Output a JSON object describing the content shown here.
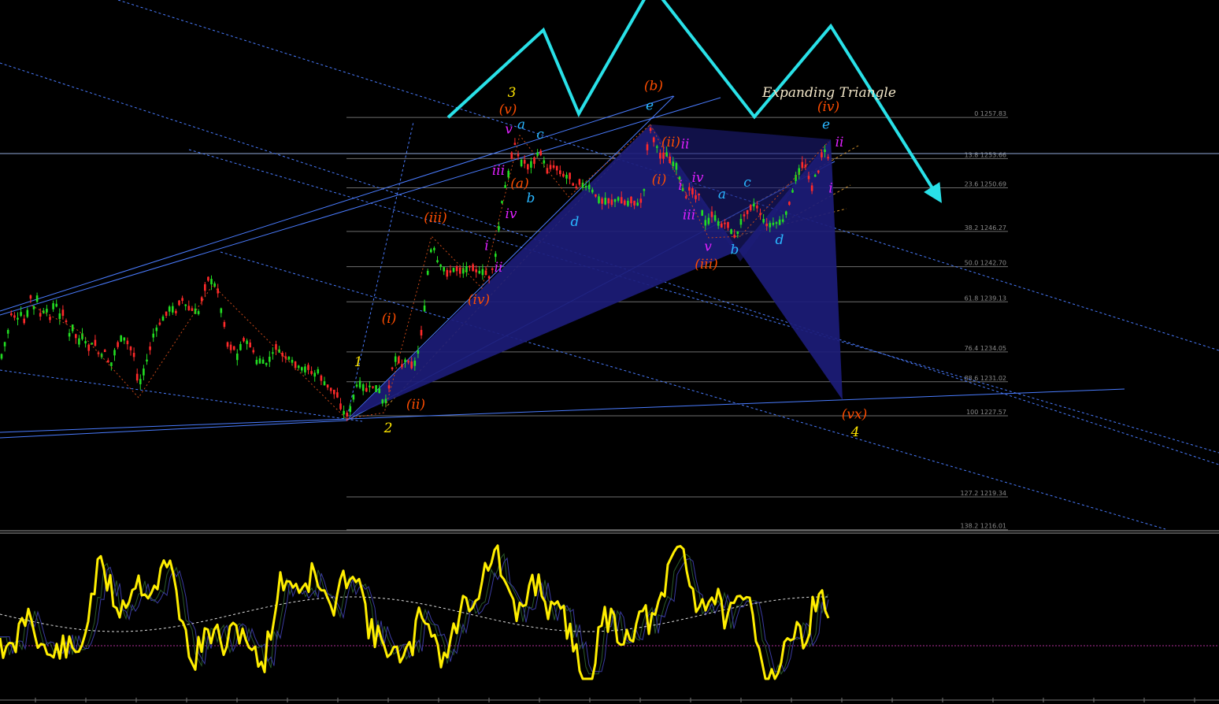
{
  "chart_data": [
    {
      "type": "candlestick",
      "title": "Expanding Triangle",
      "colors": {
        "up": "#22dd22",
        "down": "#ff2a2a",
        "pattern_fill": "#1c1c78",
        "projection": "#29e1e8",
        "fib_line": "#6e6e6e",
        "channel": "#4a7cff"
      },
      "fib_levels": [
        {
          "label": "0 1257.83",
          "price": 1257.83
        },
        {
          "label": "13.8 1253.66",
          "price": 1253.66
        },
        {
          "label": "23.6 1250.69",
          "price": 1250.69
        },
        {
          "label": "38.2 1246.27",
          "price": 1246.27
        },
        {
          "label": "50.0 1242.70",
          "price": 1242.7
        },
        {
          "label": "61.8 1239.13",
          "price": 1239.13
        },
        {
          "label": "76.4 1234.05",
          "price": 1234.05
        },
        {
          "label": "88.6 1231.02",
          "price": 1231.02
        },
        {
          "label": "100 1227.57",
          "price": 1227.57
        },
        {
          "label": "127.2 1219.34",
          "price": 1219.34
        },
        {
          "label": "138.2 1216.01",
          "price": 1216.01
        }
      ],
      "price_path": [
        [
          0,
          1233
        ],
        [
          5,
          1234.5
        ],
        [
          10,
          1236
        ],
        [
          16,
          1238.6
        ],
        [
          20,
          1237
        ],
        [
          26,
          1238
        ],
        [
          33,
          1236.8
        ],
        [
          38,
          1240
        ],
        [
          42,
          1238.3
        ],
        [
          47,
          1239.5
        ],
        [
          52,
          1237.5
        ],
        [
          58,
          1238.6
        ],
        [
          63,
          1237.3
        ],
        [
          70,
          1239.4
        ],
        [
          75,
          1237.6
        ],
        [
          82,
          1238.2
        ],
        [
          87,
          1235.6
        ],
        [
          94,
          1236.8
        ],
        [
          98,
          1234.8
        ],
        [
          105,
          1235.7
        ],
        [
          112,
          1234.4
        ],
        [
          120,
          1235.2
        ],
        [
          127,
          1233.4
        ],
        [
          133,
          1234.2
        ],
        [
          140,
          1232.4
        ],
        [
          147,
          1234.4
        ],
        [
          155,
          1235.6
        ],
        [
          162,
          1235
        ],
        [
          170,
          1233.8
        ],
        [
          176,
          1230.5
        ],
        [
          182,
          1231.9
        ],
        [
          188,
          1233.6
        ],
        [
          195,
          1235.8
        ],
        [
          202,
          1236.8
        ],
        [
          210,
          1237.8
        ],
        [
          217,
          1238.6
        ],
        [
          223,
          1238
        ],
        [
          230,
          1239.6
        ],
        [
          237,
          1238.6
        ],
        [
          245,
          1238.3
        ],
        [
          252,
          1238
        ],
        [
          259,
          1240.3
        ],
        [
          265,
          1241.6
        ],
        [
          270,
          1241
        ],
        [
          276,
          1240.6
        ],
        [
          280,
          1238.5
        ],
        [
          285,
          1236.8
        ],
        [
          290,
          1234.3
        ],
        [
          296,
          1234.7
        ],
        [
          302,
          1233.4
        ],
        [
          308,
          1235.4
        ],
        [
          314,
          1235
        ],
        [
          320,
          1234.6
        ],
        [
          326,
          1233
        ],
        [
          332,
          1233.2
        ],
        [
          338,
          1232.8
        ],
        [
          344,
          1233.5
        ],
        [
          350,
          1234.6
        ],
        [
          356,
          1234
        ],
        [
          362,
          1233.5
        ],
        [
          368,
          1233.4
        ],
        [
          374,
          1232.8
        ],
        [
          380,
          1232.5
        ],
        [
          386,
          1232.2
        ],
        [
          392,
          1232.5
        ],
        [
          398,
          1231.6
        ],
        [
          404,
          1232.1
        ],
        [
          410,
          1231
        ],
        [
          416,
          1230.6
        ],
        [
          422,
          1230.1
        ],
        [
          428,
          1229.8
        ],
        [
          434,
          1228.1
        ],
        [
          440,
          1227.6
        ],
        [
          446,
          1228.4
        ],
        [
          452,
          1230.6
        ],
        [
          458,
          1230.8
        ],
        [
          464,
          1230.1
        ],
        [
          470,
          1230.6
        ],
        [
          476,
          1230.4
        ],
        [
          482,
          1230.1
        ],
        [
          488,
          1228.4
        ],
        [
          494,
          1230.5
        ],
        [
          499,
          1232.8
        ],
        [
          504,
          1233.6
        ],
        [
          510,
          1232.6
        ],
        [
          515,
          1233.2
        ],
        [
          520,
          1233
        ],
        [
          525,
          1232.5
        ],
        [
          530,
          1233.6
        ],
        [
          535,
          1236
        ],
        [
          540,
          1239
        ],
        [
          545,
          1243.8
        ],
        [
          550,
          1244.9
        ],
        [
          556,
          1243.1
        ],
        [
          562,
          1242.6
        ],
        [
          568,
          1242
        ],
        [
          574,
          1242.3
        ],
        [
          580,
          1242.5
        ],
        [
          586,
          1242.2
        ],
        [
          592,
          1242.4
        ],
        [
          598,
          1242.8
        ],
        [
          604,
          1242.3
        ],
        [
          610,
          1242.1
        ],
        [
          616,
          1242.2
        ],
        [
          621,
          1241.6
        ],
        [
          626,
          1242.6
        ],
        [
          631,
          1244.5
        ],
        [
          635,
          1248
        ],
        [
          640,
          1250.5
        ],
        [
          644,
          1251.3
        ],
        [
          649,
          1253.6
        ],
        [
          653,
          1255.4
        ],
        [
          657,
          1254.3
        ],
        [
          661,
          1253.1
        ],
        [
          665,
          1253.5
        ],
        [
          670,
          1252.8
        ],
        [
          675,
          1253.1
        ],
        [
          680,
          1253.6
        ],
        [
          685,
          1254.6
        ],
        [
          690,
          1253.5
        ],
        [
          695,
          1252.4
        ],
        [
          700,
          1252.9
        ],
        [
          706,
          1252.8
        ],
        [
          712,
          1252.2
        ],
        [
          718,
          1251.8
        ],
        [
          724,
          1251.9
        ],
        [
          730,
          1250.5
        ],
        [
          736,
          1251.3
        ],
        [
          742,
          1250.8
        ],
        [
          748,
          1250.8
        ],
        [
          754,
          1250.2
        ],
        [
          760,
          1249.5
        ],
        [
          766,
          1249.3
        ],
        [
          772,
          1249.4
        ],
        [
          778,
          1249.2
        ],
        [
          784,
          1249.6
        ],
        [
          790,
          1249.4
        ],
        [
          796,
          1249
        ],
        [
          802,
          1249.5
        ],
        [
          808,
          1248.9
        ],
        [
          814,
          1249.4
        ],
        [
          818,
          1250.5
        ],
        [
          822,
          1254.8
        ],
        [
          825,
          1256.9
        ],
        [
          830,
          1255.6
        ],
        [
          835,
          1254.7
        ],
        [
          840,
          1253.6
        ],
        [
          845,
          1254.3
        ],
        [
          850,
          1253.6
        ],
        [
          855,
          1253.1
        ],
        [
          860,
          1252.8
        ],
        [
          864,
          1251.3
        ],
        [
          868,
          1250.3
        ],
        [
          872,
          1249.6
        ],
        [
          877,
          1251.1
        ],
        [
          882,
          1249.5
        ],
        [
          887,
          1250.3
        ],
        [
          892,
          1248
        ],
        [
          896,
          1247.1
        ],
        [
          901,
          1247.4
        ],
        [
          905,
          1248.2
        ],
        [
          910,
          1247.3
        ],
        [
          915,
          1246.8
        ],
        [
          920,
          1247.1
        ],
        [
          925,
          1246.9
        ],
        [
          930,
          1246
        ],
        [
          935,
          1245.6
        ],
        [
          940,
          1247.1
        ],
        [
          945,
          1247.9
        ],
        [
          950,
          1248.3
        ],
        [
          955,
          1248.9
        ],
        [
          960,
          1249
        ],
        [
          965,
          1248.1
        ],
        [
          970,
          1247.3
        ],
        [
          975,
          1246.8
        ],
        [
          980,
          1247
        ],
        [
          985,
          1247.1
        ],
        [
          990,
          1247.2
        ],
        [
          995,
          1247.4
        ],
        [
          1000,
          1248.5
        ],
        [
          1005,
          1249.8
        ],
        [
          1010,
          1251.6
        ],
        [
          1015,
          1252.4
        ],
        [
          1020,
          1253.2
        ],
        [
          1025,
          1252.7
        ],
        [
          1030,
          1250.3
        ],
        [
          1035,
          1251.9
        ],
        [
          1040,
          1252.4
        ],
        [
          1045,
          1254.8
        ],
        [
          1050,
          1254.1
        ],
        [
          1055,
          1253
        ]
      ],
      "wave_labels": [
        {
          "text": "1",
          "color": "#ffe600",
          "at": [
            455,
            1232.6
          ]
        },
        {
          "text": "2",
          "color": "#ffe600",
          "at": [
            493,
            1225.9
          ]
        },
        {
          "text": "3",
          "color": "#ffe600",
          "at": [
            650,
            1259.9
          ]
        },
        {
          "text": "4",
          "color": "#ffe600",
          "at": [
            1086,
            1225.5
          ]
        },
        {
          "text": "(i)",
          "color": "#ff4d00",
          "at": [
            494,
            1237.0
          ]
        },
        {
          "text": "(ii)",
          "color": "#ff4d00",
          "at": [
            528,
            1228.3
          ]
        },
        {
          "text": "(iii)",
          "color": "#ff4d00",
          "at": [
            553,
            1247.2
          ]
        },
        {
          "text": "(iv)",
          "color": "#ff4d00",
          "at": [
            608,
            1238.9
          ]
        },
        {
          "text": "(v)",
          "color": "#ff4d00",
          "at": [
            645,
            1258.2
          ]
        },
        {
          "text": "(b)",
          "color": "#ff4d00",
          "at": [
            830,
            1260.6
          ]
        },
        {
          "text": "(ii)",
          "color": "#ff4d00",
          "at": [
            852,
            1254.9
          ]
        },
        {
          "text": "(i)",
          "color": "#ff4d00",
          "at": [
            837,
            1251.1
          ]
        },
        {
          "text": "(iii)",
          "color": "#ff4d00",
          "at": [
            897,
            1242.5
          ]
        },
        {
          "text": "(iv)",
          "color": "#ff4d00",
          "at": [
            1052,
            1258.5
          ]
        },
        {
          "text": "(vx)",
          "color": "#ff4d00",
          "at": [
            1085,
            1227.3
          ]
        },
        {
          "text": "(a)",
          "color": "#ff4d00",
          "at": [
            660,
            1250.7
          ]
        },
        {
          "text": "v",
          "color": "#e020ff",
          "at": [
            646,
            1256.2
          ]
        },
        {
          "text": "iii",
          "color": "#e020ff",
          "at": [
            633,
            1252.0
          ]
        },
        {
          "text": "iv",
          "color": "#e020ff",
          "at": [
            649,
            1247.6
          ]
        },
        {
          "text": "i",
          "color": "#e020ff",
          "at": [
            618,
            1244.4
          ]
        },
        {
          "text": "ii",
          "color": "#e020ff",
          "at": [
            633,
            1242.2
          ]
        },
        {
          "text": "ii",
          "color": "#e020ff",
          "at": [
            870,
            1254.7
          ]
        },
        {
          "text": "iv",
          "color": "#e020ff",
          "at": [
            886,
            1251.3
          ]
        },
        {
          "text": "i",
          "color": "#e020ff",
          "at": [
            864,
            1250.5
          ]
        },
        {
          "text": "iii",
          "color": "#e020ff",
          "at": [
            875,
            1247.5
          ]
        },
        {
          "text": "v",
          "color": "#e020ff",
          "at": [
            899,
            1244.3
          ]
        },
        {
          "text": "ii",
          "color": "#e020ff",
          "at": [
            1066,
            1254.9
          ]
        },
        {
          "text": "i",
          "color": "#e020ff",
          "at": [
            1055,
            1250.2
          ]
        },
        {
          "text": "a",
          "color": "#29b6ff",
          "at": [
            662,
            1256.7
          ]
        },
        {
          "text": "b",
          "color": "#29b6ff",
          "at": [
            674,
            1249.2
          ]
        },
        {
          "text": "c",
          "color": "#29b6ff",
          "at": [
            686,
            1255.7
          ]
        },
        {
          "text": "d",
          "color": "#29b6ff",
          "at": [
            730,
            1246.8
          ]
        },
        {
          "text": "e",
          "color": "#29b6ff",
          "at": [
            825,
            1258.6
          ]
        },
        {
          "text": "a",
          "color": "#29b6ff",
          "at": [
            917,
            1249.6
          ]
        },
        {
          "text": "b",
          "color": "#29b6ff",
          "at": [
            933,
            1244.0
          ]
        },
        {
          "text": "c",
          "color": "#29b6ff",
          "at": [
            949,
            1250.8
          ]
        },
        {
          "text": "d",
          "color": "#29b6ff",
          "at": [
            990,
            1245.0
          ]
        },
        {
          "text": "e",
          "color": "#29b6ff",
          "at": [
            1049,
            1256.7
          ]
        }
      ],
      "projection_path": [
        [
          569,
          1257.83
        ],
        [
          690,
          1266.7
        ],
        [
          735,
          1258.2
        ],
        [
          828,
          1271.2
        ],
        [
          958,
          1257.9
        ],
        [
          1055,
          1267.1
        ],
        [
          1190,
          1249.9
        ]
      ]
    },
    {
      "type": "line",
      "name": "oscillator",
      "colors": {
        "main": "#ffee00",
        "signal": "#dddddd",
        "zero_line": "#b0309a"
      }
    }
  ]
}
